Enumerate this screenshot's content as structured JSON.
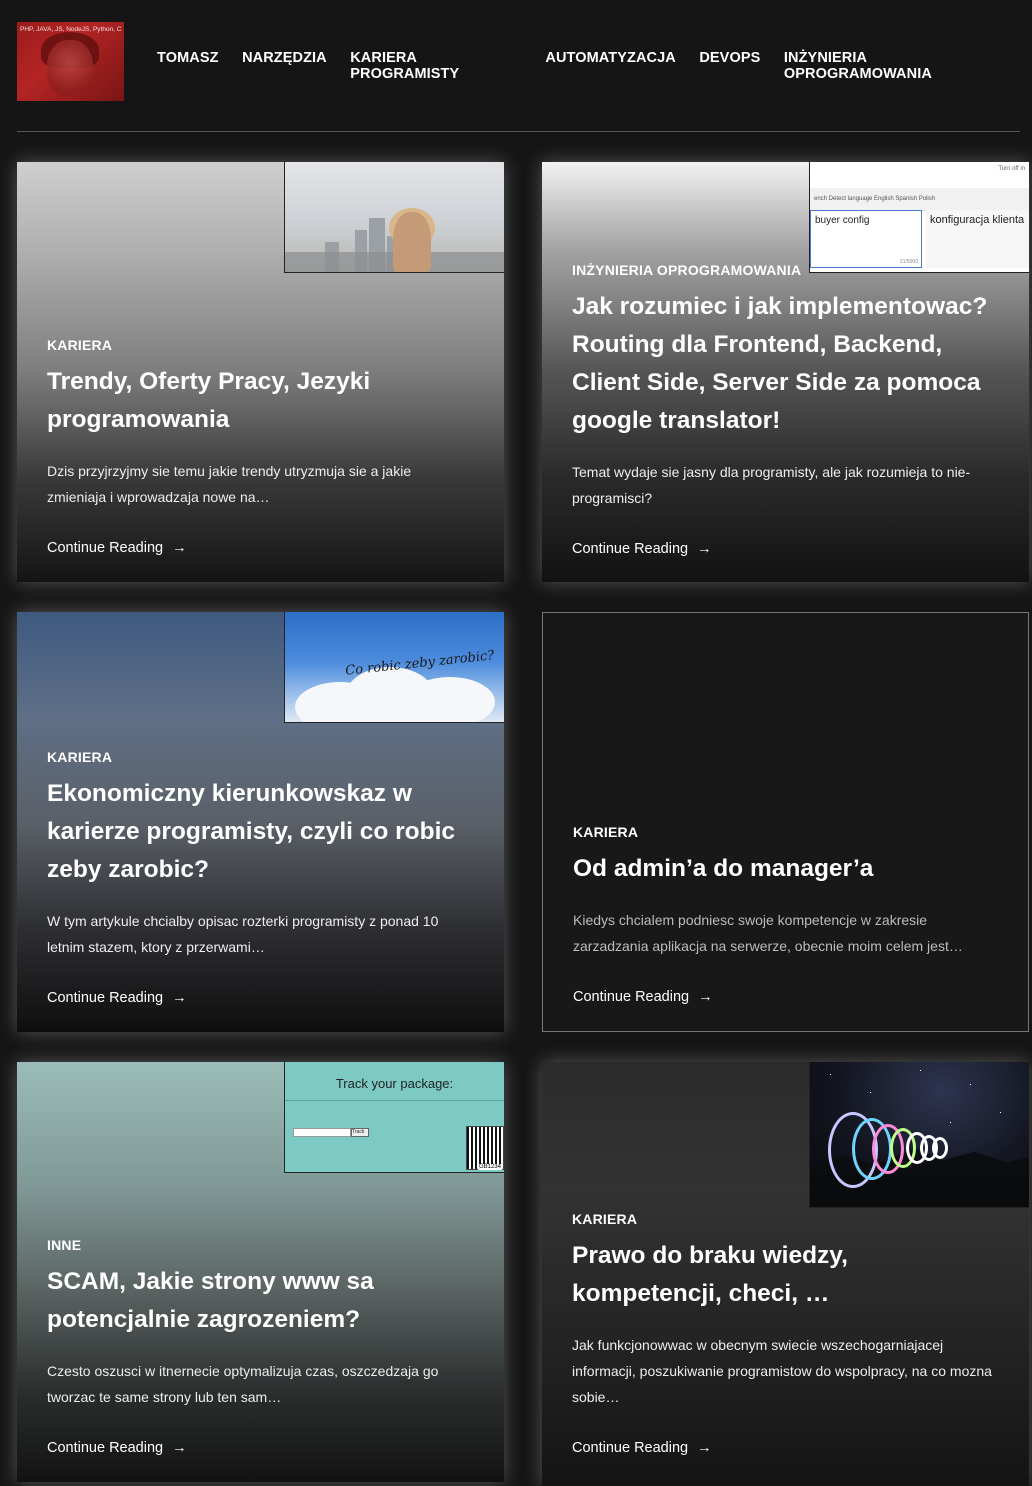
{
  "header": {
    "logo_text": "PHP, JAVA, JS, NodeJS, Python, C",
    "nav": [
      "TOMASZ",
      "NARZĘDZIA",
      "KARIERA PROGRAMISTY",
      "AUTOMATYZACJA",
      "DEVOPS",
      "INŻYNIERIA OPROGRAMOWANIA"
    ]
  },
  "posts": [
    {
      "category": "KARIERA",
      "title": "Trendy, Oferty Pracy, Jezyki programowania",
      "excerpt": "Dzis przyjrzyjmy sie temu jakie trendy utryzmuja sie a jakie zmieniaja i wprowadzaja nowe na…",
      "more": "Continue Reading",
      "arrow": "→"
    },
    {
      "category": "INŻYNIERIA OPROGRAMOWANIA",
      "title": "Jak rozumiec i jak implementowac? Routing dla Frontend, Backend, Client Side, Server Side za pomoca google translator!",
      "excerpt": "Temat wydaje sie jasny dla programisty, ale jak rozumieja to nie-programisci?",
      "more": "Continue Reading",
      "arrow": "→",
      "thumb": {
        "top_text": "Turn off in",
        "bar_text": "ench  Detect language          English  Spanish  Polish",
        "source": "buyer config",
        "target": "konfiguracja klienta",
        "count": "21/5000"
      }
    },
    {
      "category": "KARIERA",
      "title": "Ekonomiczny kierunkowskaz w karierze programisty, czyli co robic zeby zarobic?",
      "excerpt": "W tym artykule chcialby opisac rozterki programisty z ponad 10 letnim stazem, ktory z przerwami…",
      "more": "Continue Reading",
      "arrow": "→",
      "thumb": {
        "script": "Co robic zeby zarobic?"
      }
    },
    {
      "category": "KARIERA",
      "title": "Od admin’a do manager’a",
      "excerpt": "Kiedys chcialem podniesc swoje kompetencje w zakresie zarzadzania aplikacja na serwerze, obecnie moim celem jest…",
      "more": "Continue Reading",
      "arrow": "→"
    },
    {
      "category": "INNE",
      "title": "SCAM, Jakie strony www sa potencjalnie zagrozeniem?",
      "excerpt": "Czesto oszusci w itnernecie optymalizuja czas, oszczedzaja go tworzac te same strony lub ten sam…",
      "more": "Continue Reading",
      "arrow": "→",
      "thumb": {
        "heading": "Track your package:",
        "button": "Track",
        "barcode_text": "GB1234"
      }
    },
    {
      "category": "KARIERA",
      "title": "Prawo do braku wiedzy, kompetencji, checi, …",
      "excerpt": "Jak funkcjonowwac w obecnym swiecie wszechogarniajacej informacji, poszukiwanie programistow do wspolpracy, na co mozna sobie…",
      "more": "Continue Reading",
      "arrow": "→"
    }
  ]
}
